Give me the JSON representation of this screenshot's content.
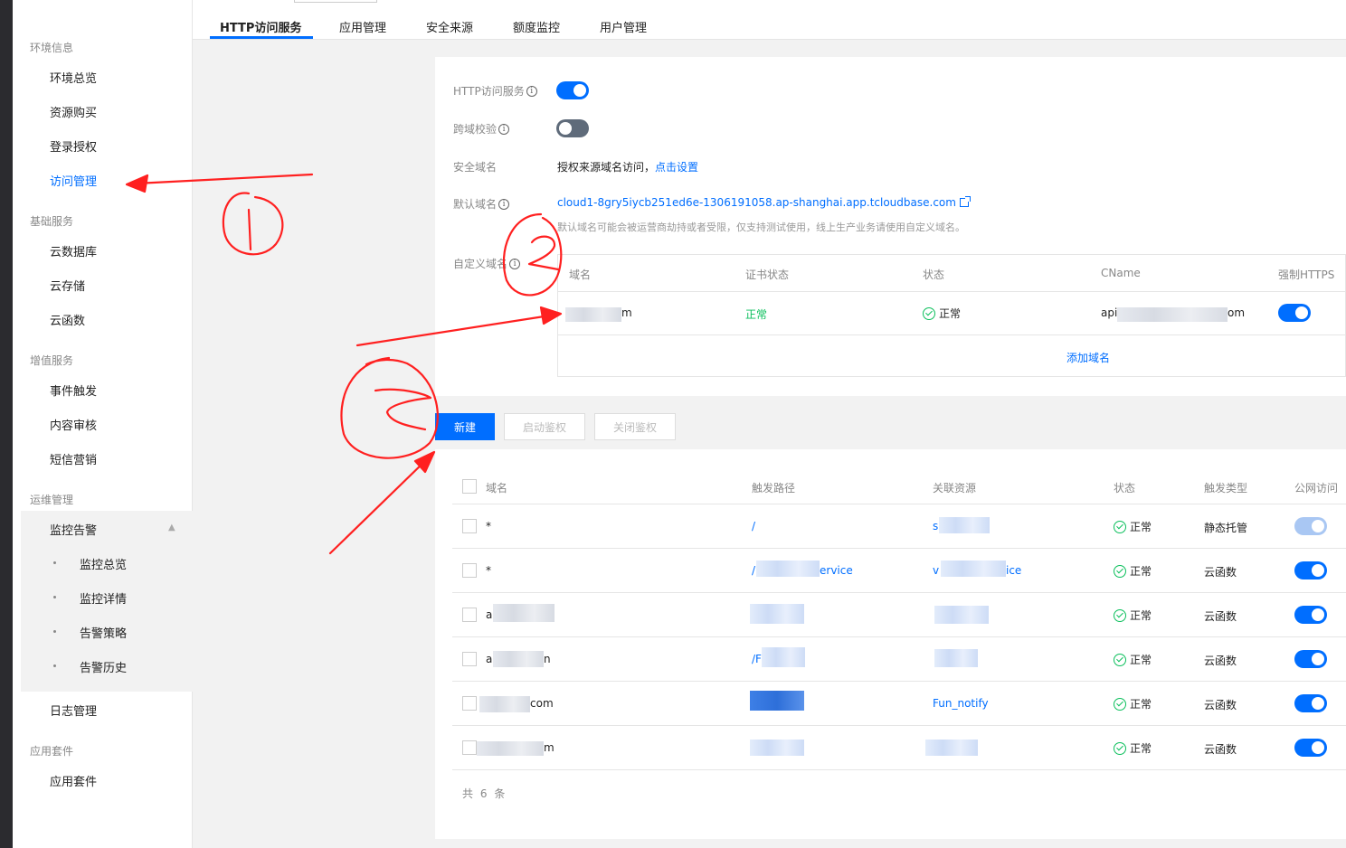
{
  "sidebar": {
    "sections": [
      {
        "title": "环境信息",
        "items": [
          "环境总览",
          "资源购买",
          "登录授权",
          "访问管理"
        ]
      },
      {
        "title": "基础服务",
        "items": [
          "云数据库",
          "云存储",
          "云函数"
        ]
      },
      {
        "title": "增值服务",
        "items": [
          "事件触发",
          "内容审核",
          "短信营销"
        ]
      },
      {
        "title": "运维管理",
        "items": [
          "监控告警",
          "日志管理"
        ]
      },
      {
        "title": "应用套件",
        "items": [
          "应用套件"
        ]
      }
    ],
    "monitor_sub": [
      "监控总览",
      "监控详情",
      "告警策略",
      "告警历史"
    ],
    "active": "访问管理"
  },
  "tabs": [
    "HTTP访问服务",
    "应用管理",
    "安全来源",
    "额度监控",
    "用户管理"
  ],
  "config": {
    "http_label": "HTTP访问服务",
    "cors_label": "跨域校验",
    "safe_domain_label": "安全域名",
    "safe_domain_text": "授权来源域名访问，",
    "safe_domain_link": "点击设置",
    "default_domain_label": "默认域名",
    "default_domain_value": "cloud1-8gry5iycb251ed6e-1306191058.ap-shanghai.app.tcloudbase.com",
    "default_domain_hint": "默认域名可能会被运营商劫持或者受限，仅支持测试使用，线上生产业务请使用自定义域名。",
    "custom_domain_label": "自定义域名",
    "http_enabled": true,
    "cors_enabled": false
  },
  "domain_table": {
    "headers": [
      "域名",
      "证书状态",
      "状态",
      "CName",
      "强制HTTPS"
    ],
    "row": {
      "domain_tail": "m",
      "cert": "正常",
      "status": "正常",
      "cname_head": "api",
      "cname_tail": "om",
      "https": true
    },
    "add_link": "添加域名"
  },
  "actions": {
    "new": "新建",
    "enable_auth": "启动鉴权",
    "disable_auth": "关闭鉴权"
  },
  "routes": {
    "headers": [
      "域名",
      "触发路径",
      "关联资源",
      "状态",
      "触发类型",
      "公网访问"
    ],
    "rows": [
      {
        "domain": "*",
        "path": "/",
        "resource": "s",
        "status": "正常",
        "type": "静态托管",
        "public": "disabled-on"
      },
      {
        "domain": "*",
        "path": "/",
        "path_tail": "ervice",
        "resource": "v",
        "resource_tail": "ice",
        "status": "正常",
        "type": "云函数",
        "public": "on"
      },
      {
        "domain": "a",
        "path": "",
        "resource": "",
        "status": "正常",
        "type": "云函数",
        "public": "on"
      },
      {
        "domain": "a",
        "domain_tail": "n",
        "path": "/F",
        "resource": "",
        "status": "正常",
        "type": "云函数",
        "public": "on"
      },
      {
        "domain": "",
        "domain_tail": "com",
        "path": "",
        "resource": "Fun_notify",
        "status": "正常",
        "type": "云函数",
        "public": "on"
      },
      {
        "domain": "",
        "domain_tail": "m",
        "path": "",
        "resource": "",
        "status": "正常",
        "type": "云函数",
        "public": "on"
      }
    ],
    "total_prefix": "共",
    "total": "6",
    "total_suffix": "条"
  },
  "colors": {
    "accent": "#006eff",
    "success": "#0abf5b",
    "annotation": "#ff2020"
  }
}
